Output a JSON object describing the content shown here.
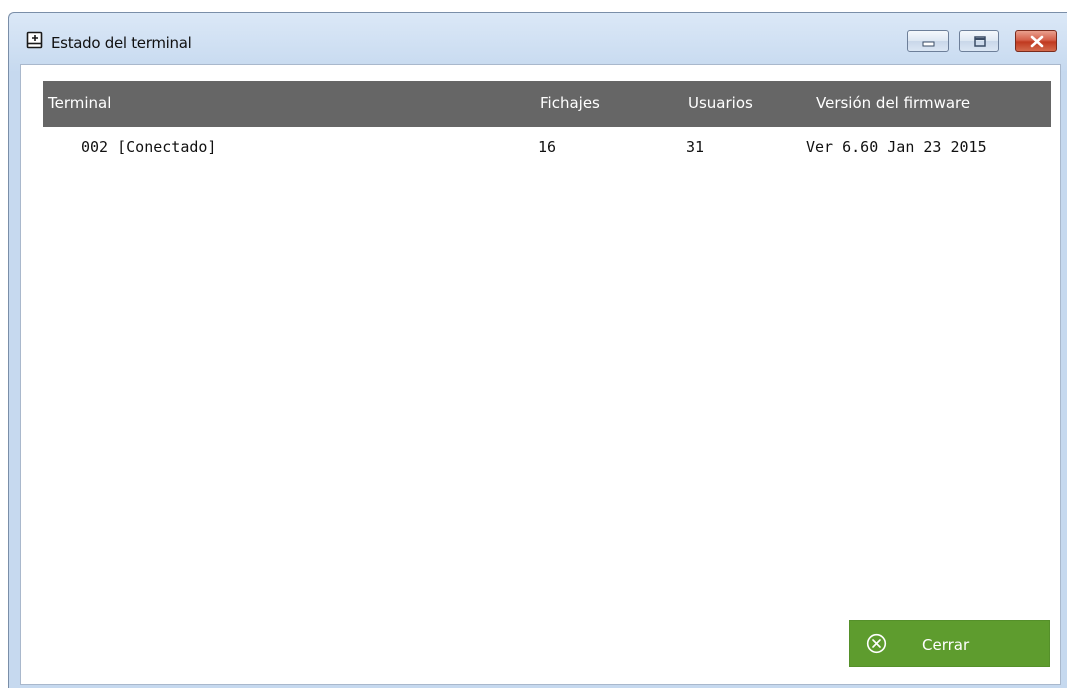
{
  "window": {
    "title": "Estado del terminal"
  },
  "table": {
    "headers": {
      "terminal": "Terminal",
      "fichajes": "Fichajes",
      "usuarios": "Usuarios",
      "firmware": "Versión del firmware"
    },
    "rows": [
      {
        "terminal": "002 [Conectado]",
        "fichajes": "16",
        "usuarios": "31",
        "firmware": "Ver 6.60 Jan 23 2015"
      }
    ]
  },
  "footer": {
    "close_label": "Cerrar"
  },
  "icons": {
    "app": "terminal-icon",
    "minimize": "minimize-icon",
    "maximize": "maximize-icon",
    "close": "close-icon",
    "close_button": "circle-x-icon"
  },
  "colors": {
    "header_bg": "#666666",
    "button_green": "#5e9c2e",
    "window_close_red": "#c7452b"
  }
}
